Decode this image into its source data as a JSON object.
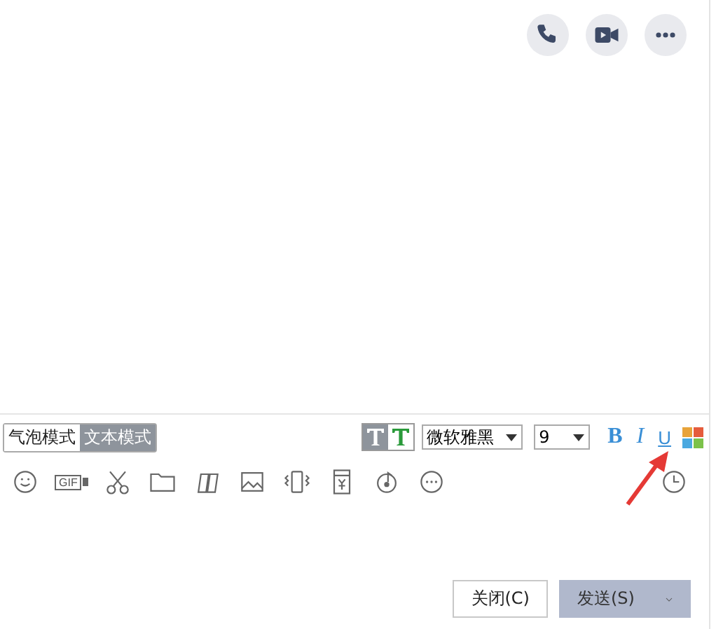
{
  "header_actions": [
    {
      "kind": "phone"
    },
    {
      "kind": "video"
    },
    {
      "kind": "more"
    }
  ],
  "modes": [
    {
      "label": "气泡模式",
      "selected": false
    },
    {
      "label": "文本模式",
      "selected": true
    }
  ],
  "text_style": [
    {
      "kind": "plain",
      "selected": true
    },
    {
      "kind": "color",
      "selected": false
    }
  ],
  "font": {
    "value": "微软雅黑"
  },
  "size": {
    "value": "9"
  },
  "format_buttons": [
    {
      "kind": "bold",
      "label": "B"
    },
    {
      "kind": "italic",
      "label": "I"
    },
    {
      "kind": "underline",
      "label": "U"
    },
    {
      "kind": "palette"
    }
  ],
  "tools": [
    {
      "kind": "emoji"
    },
    {
      "kind": "gif",
      "label": "GIF"
    },
    {
      "kind": "scissors"
    },
    {
      "kind": "folder"
    },
    {
      "kind": "doodle"
    },
    {
      "kind": "image"
    },
    {
      "kind": "shake"
    },
    {
      "kind": "redpacket"
    },
    {
      "kind": "music"
    },
    {
      "kind": "more"
    }
  ],
  "history": {
    "kind": "clock"
  },
  "buttons": [
    {
      "label": "关闭(C)",
      "kind": "secondary"
    },
    {
      "label": "发送(S)",
      "kind": "primary"
    }
  ]
}
